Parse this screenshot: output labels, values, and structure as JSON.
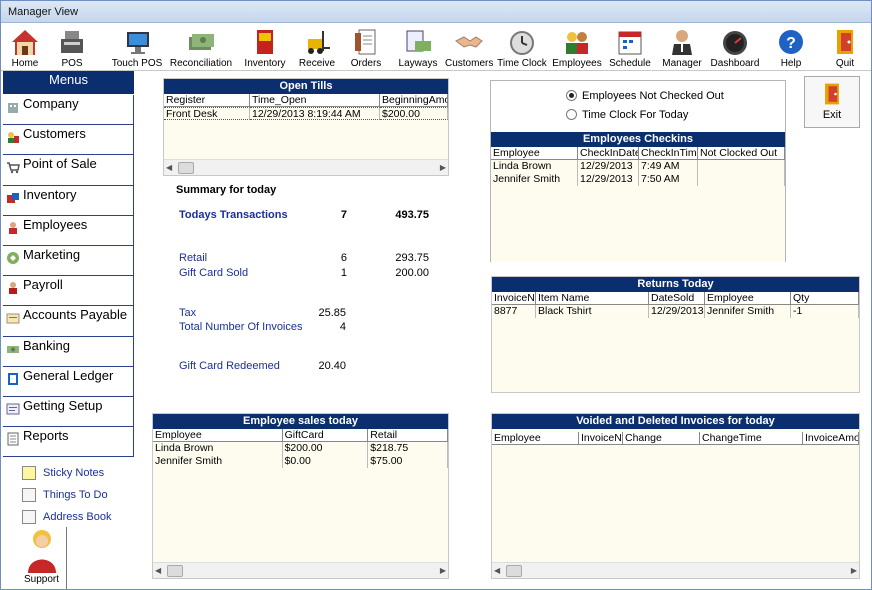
{
  "window": {
    "title": "Manager View"
  },
  "toolbar": [
    {
      "label": "Home",
      "icon": "home-icon"
    },
    {
      "label": "POS",
      "icon": "cash-register-icon"
    },
    {
      "label": "Touch POS",
      "icon": "touch-monitor-icon"
    },
    {
      "label": "Reconciliation",
      "icon": "money-icon"
    },
    {
      "label": "Inventory",
      "icon": "inventory-book-icon"
    },
    {
      "label": "Receive",
      "icon": "forklift-icon"
    },
    {
      "label": "Orders",
      "icon": "orders-document-icon"
    },
    {
      "label": "Layways",
      "icon": "layaway-icon"
    },
    {
      "label": "Customers",
      "icon": "handshake-icon"
    },
    {
      "label": "Time Clock",
      "icon": "clock-icon"
    },
    {
      "label": "Employees",
      "icon": "employees-icon"
    },
    {
      "label": "Schedule",
      "icon": "calendar-icon"
    },
    {
      "label": "Manager",
      "icon": "manager-icon"
    },
    {
      "label": "Dashboard",
      "icon": "gauge-icon"
    },
    {
      "label": "Help",
      "icon": "help-icon"
    },
    {
      "label": "Quit",
      "icon": "exit-door-icon"
    }
  ],
  "sidebar": {
    "header": "Menus",
    "items": [
      "Company",
      "Customers",
      "Point of Sale",
      "Inventory",
      "Employees",
      "Marketing",
      "Payroll",
      "Accounts Payable",
      "Banking",
      "General Ledger",
      "Getting Setup",
      "Reports"
    ],
    "links": [
      "Sticky Notes",
      "Things To Do",
      "Address Book"
    ],
    "support": "Support"
  },
  "open_tills": {
    "title": "Open Tills",
    "columns": [
      "Register",
      "Time_Open",
      "BeginningAmou"
    ],
    "rows": [
      [
        "Front Desk",
        "12/29/2013 8:19:44 AM",
        "$200.00"
      ]
    ]
  },
  "summary": {
    "heading": "Summary for today",
    "todays_transactions": {
      "label": "Todays Transactions",
      "count": "7",
      "amount": "493.75"
    },
    "retail": {
      "label": "Retail",
      "count": "6",
      "amount": "293.75"
    },
    "gift_card_sold": {
      "label": "Gift Card Sold",
      "count": "1",
      "amount": "200.00"
    },
    "tax": {
      "label": "Tax",
      "value": "25.85"
    },
    "total_invoices": {
      "label": "Total Number Of Invoices",
      "value": "4"
    },
    "gift_card_redeemed": {
      "label": "Gift Card Redeemed",
      "value": "20.40"
    }
  },
  "employee_sales": {
    "title": "Employee sales today",
    "columns": [
      "Employee",
      "GiftCard",
      "Retail"
    ],
    "rows": [
      [
        "Linda Brown",
        "$200.00",
        "$218.75"
      ],
      [
        "Jennifer Smith",
        "$0.00",
        "$75.00"
      ]
    ]
  },
  "checkins": {
    "radio1": "Employees Not Checked Out",
    "radio2": "Time Clock For Today",
    "title": "Employees Checkins",
    "columns": [
      "Employee",
      "CheckInDate",
      "CheckInTime",
      "Not Clocked Out"
    ],
    "rows": [
      [
        "Linda Brown",
        "12/29/2013",
        "7:49 AM",
        ""
      ],
      [
        "Jennifer Smith",
        "12/29/2013",
        "7:50 AM",
        ""
      ]
    ]
  },
  "exit": {
    "label": "Exit"
  },
  "returns": {
    "title": "Returns Today",
    "columns": [
      "InvoiceNu",
      "Item Name",
      "DateSold",
      "Employee",
      "Qty"
    ],
    "rows": [
      [
        "8877",
        "Black Tshirt",
        "12/29/2013",
        "Jennifer Smith",
        "-1"
      ]
    ]
  },
  "voided": {
    "title": "Voided and Deleted Invoices for today",
    "columns": [
      "Employee",
      "InvoiceN",
      "Change",
      "ChangeTime",
      "InvoiceAmou"
    ]
  },
  "colors": {
    "header_blue": "#0b2f6e",
    "link_blue": "#1a2f9a",
    "panel_bg": "#fdfcef"
  }
}
